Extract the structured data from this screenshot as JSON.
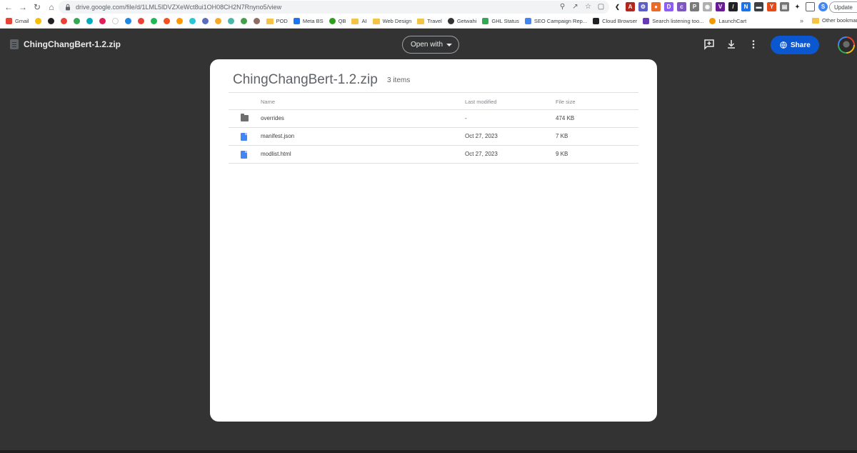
{
  "browser": {
    "url": "drive.google.com/file/d/1LML5lDVZXeWct8ui1OH08CH2N7Rnyno5/view",
    "update_label": "Update",
    "bookmarks": [
      {
        "label": "Gmail",
        "color": "#ea4335"
      },
      {
        "label": "POD",
        "folder": true
      },
      {
        "label": "Meta BS",
        "color": "#1877f2"
      },
      {
        "label": "QB",
        "color": "#2ca01c"
      },
      {
        "label": "AI",
        "folder": true
      },
      {
        "label": "Web Design",
        "folder": true
      },
      {
        "label": "Travel",
        "folder": true
      },
      {
        "label": "Getwahi",
        "color": "#333333"
      },
      {
        "label": "GHL Status",
        "color": "#34a853"
      },
      {
        "label": "SEO Campaign Rep...",
        "color": "#4285f4"
      },
      {
        "label": "Cloud Browser",
        "color": "#202124"
      },
      {
        "label": "Search listening too...",
        "color": "#673ab7"
      },
      {
        "label": "LaunchCart",
        "color": "#f29900"
      }
    ],
    "other_bookmarks": "Other bookmarks"
  },
  "viewer": {
    "title": "ChingChangBert-1.2.zip",
    "open_with_label": "Open with",
    "share_label": "Share"
  },
  "archive": {
    "title": "ChingChangBert-1.2.zip",
    "count": "3 items",
    "columns": {
      "name": "Name",
      "modified": "Last modified",
      "size": "File size"
    },
    "rows": [
      {
        "type": "folder",
        "name": "overrides",
        "modified": "-",
        "size": "474 KB"
      },
      {
        "type": "file",
        "name": "manifest.json",
        "modified": "Oct 27, 2023",
        "size": "7 KB"
      },
      {
        "type": "file",
        "name": "modlist.html",
        "modified": "Oct 27, 2023",
        "size": "9 KB"
      }
    ]
  }
}
